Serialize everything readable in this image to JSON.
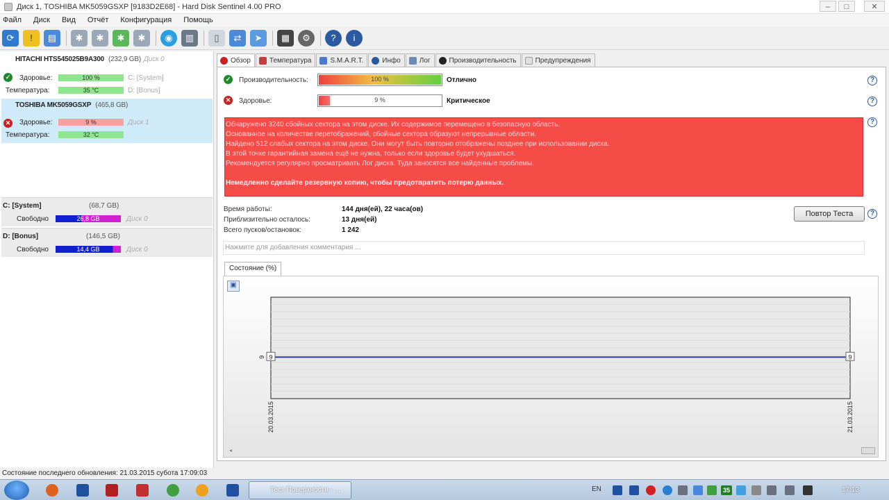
{
  "window": {
    "title": "Диск 1, TOSHIBA MK5059GSXP [9183D2E68]  -  Hard Disk Sentinel 4.00 PRO"
  },
  "menu": [
    "Файл",
    "Диск",
    "Вид",
    "Отчёт",
    "Конфигурация",
    "Помощь"
  ],
  "disks": [
    {
      "name": "HITACHI HTS545025B9A300",
      "size": "(232,9 GB)",
      "alias": "Диск 0",
      "health_label": "Здоровье:",
      "health_value": "100 %",
      "health_pct": 100,
      "health_vol": "C: [System]",
      "temp_label": "Температура:",
      "temp_value": "35 °C",
      "temp_vol": "D: [Bonus]"
    },
    {
      "name": "TOSHIBA MK5059GSXP",
      "size": "(465,8 GB)",
      "alias": "",
      "health_label": "Здоровье:",
      "health_value": "9 %",
      "health_pct": 9,
      "health_vol": "Диск 1",
      "temp_label": "Температура:",
      "temp_value": "32 °C"
    }
  ],
  "volumes": [
    {
      "name": "C: [System]",
      "size": "(68,7 GB)",
      "free_label": "Свободно",
      "free_value": "26,8 GB",
      "disk": "Диск 0"
    },
    {
      "name": "D: [Bonus]",
      "size": "(146,5 GB)",
      "free_label": "Свободно",
      "free_value": "14,4 GB",
      "disk": "Диск 0"
    }
  ],
  "tabs": [
    "Обзор",
    "Температура",
    "S.M.A.R.T.",
    "Инфо",
    "Лог",
    "Производительность",
    "Предупреждения"
  ],
  "overview": {
    "perf_label": "Производительность:",
    "perf_value": "100 %",
    "perf_pct": 100,
    "perf_status": "Отлично",
    "health_label": "Здоровье:",
    "health_value": "9 %",
    "health_pct": 9,
    "health_status": "Критическое",
    "message": [
      "Обнаружено 3240 сбойных сектора на этом диске. Их содержимое перемещено в безопасную область.",
      "Основанное на количестве перетображений, сбойные сектора образуют непрерывные области.",
      "Найдено 512 слабых сектора на этом диске. Они могут быть повторно отображены позднее при использовании диска.",
      "В этой точке гарантийная замена ещё не нужна, только если здоровье будет ухудшаться.",
      "Рекомендуется регулярно просматривать Лог диска. Туда заносятся все найденные проблемы."
    ],
    "message_strong": "Немедленно сделайте резервную копию, чтобы предотвратить потерю данных.",
    "uptime_label": "Время работы:",
    "uptime_value": "144 дня(ей), 22 часа(ов)",
    "remaining_label": "Приблизительно осталось:",
    "remaining_value": "13 дня(ей)",
    "startstop_label": "Всего пусков/остановок:",
    "startstop_value": "1 242",
    "retest_button": "Повтор Теста",
    "comment_placeholder": "Нажмите для добавления комментария ...",
    "subtab": "Состояние (%)"
  },
  "chart_data": {
    "type": "line",
    "x": [
      "20.03.2015",
      "21.03.2015"
    ],
    "series": [
      {
        "values": [
          9,
          9
        ]
      }
    ],
    "ytick": "9"
  },
  "statusbar": "Состояние последнего обновления: 21.03.2015 субота 17:09:03",
  "taskbar": {
    "task": "Тест Поверхности - ...",
    "lang": "EN",
    "clock": "17:13",
    "tray_badge": "35"
  },
  "colors": {
    "critical": "#f64c48",
    "good": "#22aa22",
    "selection": "#cfeaf8"
  }
}
